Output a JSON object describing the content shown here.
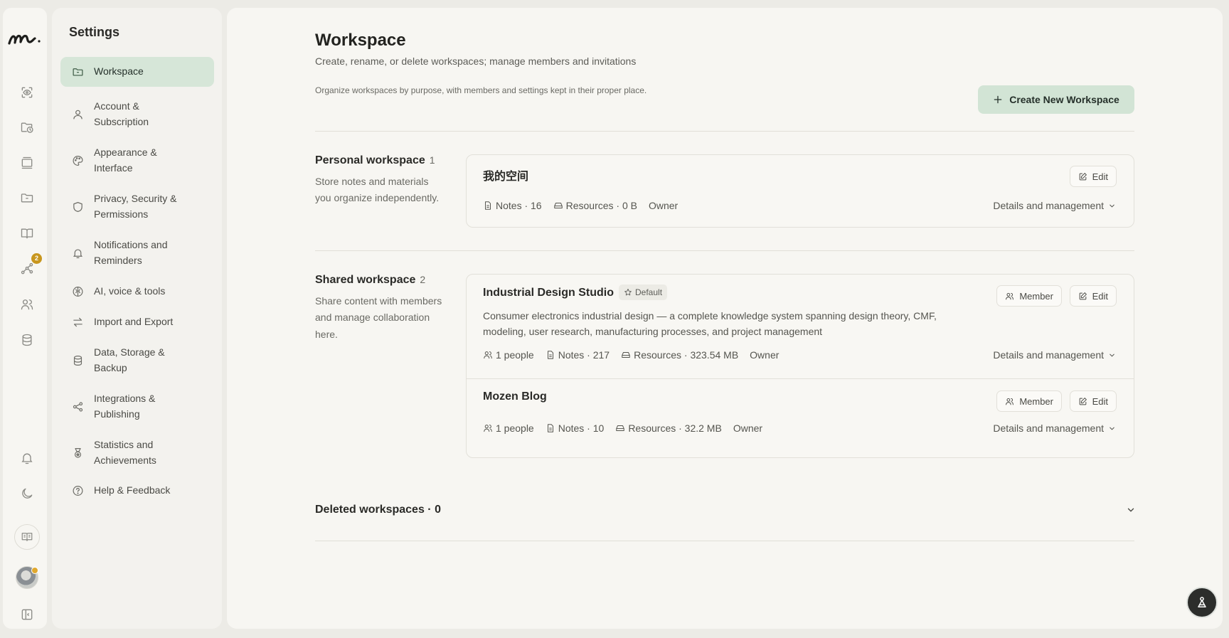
{
  "settings": {
    "title": "Settings"
  },
  "nav": [
    {
      "label": "Workspace",
      "icon": "folder-icon",
      "active": true
    },
    {
      "label": "Account & Subscription",
      "icon": "user-icon"
    },
    {
      "label": "Appearance & Interface",
      "icon": "palette-icon"
    },
    {
      "label": "Privacy, Security & Permissions",
      "icon": "shield-icon"
    },
    {
      "label": "Notifications and Reminders",
      "icon": "bell-icon"
    },
    {
      "label": "AI, voice & tools",
      "icon": "brain-icon"
    },
    {
      "label": "Import and Export",
      "icon": "arrows-icon"
    },
    {
      "label": "Data, Storage & Backup",
      "icon": "database-icon"
    },
    {
      "label": "Integrations & Publishing",
      "icon": "share-icon"
    },
    {
      "label": "Statistics and Achievements",
      "icon": "medal-icon"
    },
    {
      "label": "Help & Feedback",
      "icon": "help-icon"
    }
  ],
  "rail": {
    "badge_count": "2"
  },
  "page": {
    "title": "Workspace",
    "subtitle": "Create, rename, or delete workspaces; manage members and invitations",
    "description": "Organize workspaces by purpose, with members and settings kept in their proper place.",
    "create_label": "Create New Workspace"
  },
  "personal": {
    "title": "Personal workspace",
    "count": "1",
    "description": "Store notes and materials you organize independently.",
    "workspaces": [
      {
        "name": "我的空间",
        "notes": "Notes · 16",
        "resources": "Resources · 0 B",
        "role": "Owner"
      }
    ]
  },
  "shared": {
    "title": "Shared workspace",
    "count": "2",
    "description": "Share content with members and manage collaboration here.",
    "workspaces": [
      {
        "name": "Industrial Design Studio",
        "badge": "Default",
        "description": "Consumer electronics industrial design — a complete knowledge system spanning design theory, CMF, modeling, user research, manufacturing processes, and project management",
        "people": "1 people",
        "notes": "Notes · 217",
        "resources": "Resources · 323.54 MB",
        "role": "Owner"
      },
      {
        "name": "Mozen Blog",
        "people": "1 people",
        "notes": "Notes · 10",
        "resources": "Resources · 32.2 MB",
        "role": "Owner"
      }
    ]
  },
  "labels": {
    "edit": "Edit",
    "member": "Member",
    "details": "Details and management"
  },
  "deleted": {
    "label": "Deleted workspaces · 0"
  }
}
